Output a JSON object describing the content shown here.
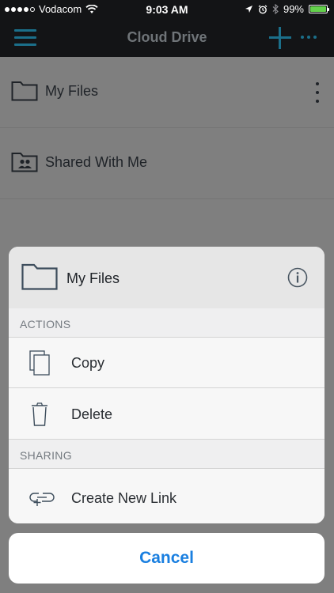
{
  "status_bar": {
    "carrier": "Vodacom",
    "time": "9:03 AM",
    "battery": "99%",
    "signal_bars": 4,
    "battery_level": 0.99
  },
  "nav": {
    "title": "Cloud Drive",
    "menu_icon": "hamburger-icon",
    "add_icon": "plus-icon",
    "more_icon": "ellipsis-icon"
  },
  "list": [
    {
      "label": "My Files",
      "icon": "folder-icon"
    },
    {
      "label": "Shared With Me",
      "icon": "shared-folder-icon"
    }
  ],
  "sheet": {
    "title": "My Files",
    "sections": {
      "actions": "ACTIONS",
      "sharing": "SHARING"
    },
    "items": {
      "copy": "Copy",
      "delete": "Delete",
      "create_link": "Create New Link"
    },
    "cancel": "Cancel"
  },
  "colors": {
    "accent": "#1a7fe0",
    "nav_accent": "#1b6f8a",
    "battery_fill": "#63d14b"
  }
}
